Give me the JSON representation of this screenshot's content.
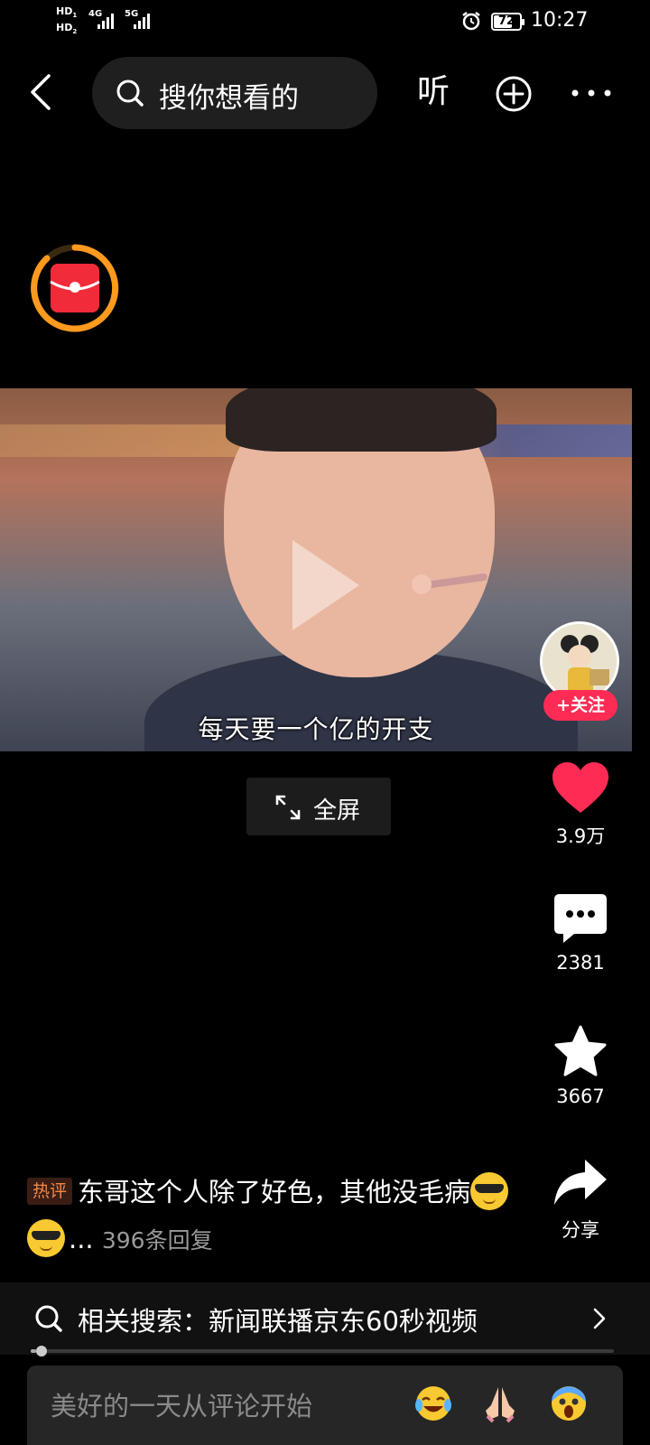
{
  "status_bar": {
    "hd1": "HD",
    "hd1_sub": "1",
    "hd2": "HD",
    "hd2_sub": "2",
    "net1": "4G",
    "net2": "5G",
    "battery": "72",
    "battery_level": 0.72,
    "time": "10:27"
  },
  "header": {
    "search_placeholder": "搜你想看的",
    "listen_label": "听"
  },
  "video": {
    "subtitle": "每天要一个亿的开支"
  },
  "author": {
    "follow_label": "+关注"
  },
  "fullscreen_label": "全屏",
  "actions": {
    "like_count": "3.9万",
    "comment_count": "2381",
    "favorite_count": "3667",
    "share_label": "分享"
  },
  "hot_comment": {
    "tag": "热评",
    "text": "东哥这个人除了好色，其他没毛病",
    "ellipsis": "...",
    "replies": "396条回复"
  },
  "related_search": {
    "text": "相关搜索：新闻联播京东60秒视频"
  },
  "progress": {
    "value": 0.01
  },
  "comment_input": {
    "placeholder": "美好的一天从评论开始"
  },
  "colors": {
    "like_red": "#fe2c55",
    "hot_tag": "#f28a47",
    "ring_orange": "#ff9a1f"
  }
}
